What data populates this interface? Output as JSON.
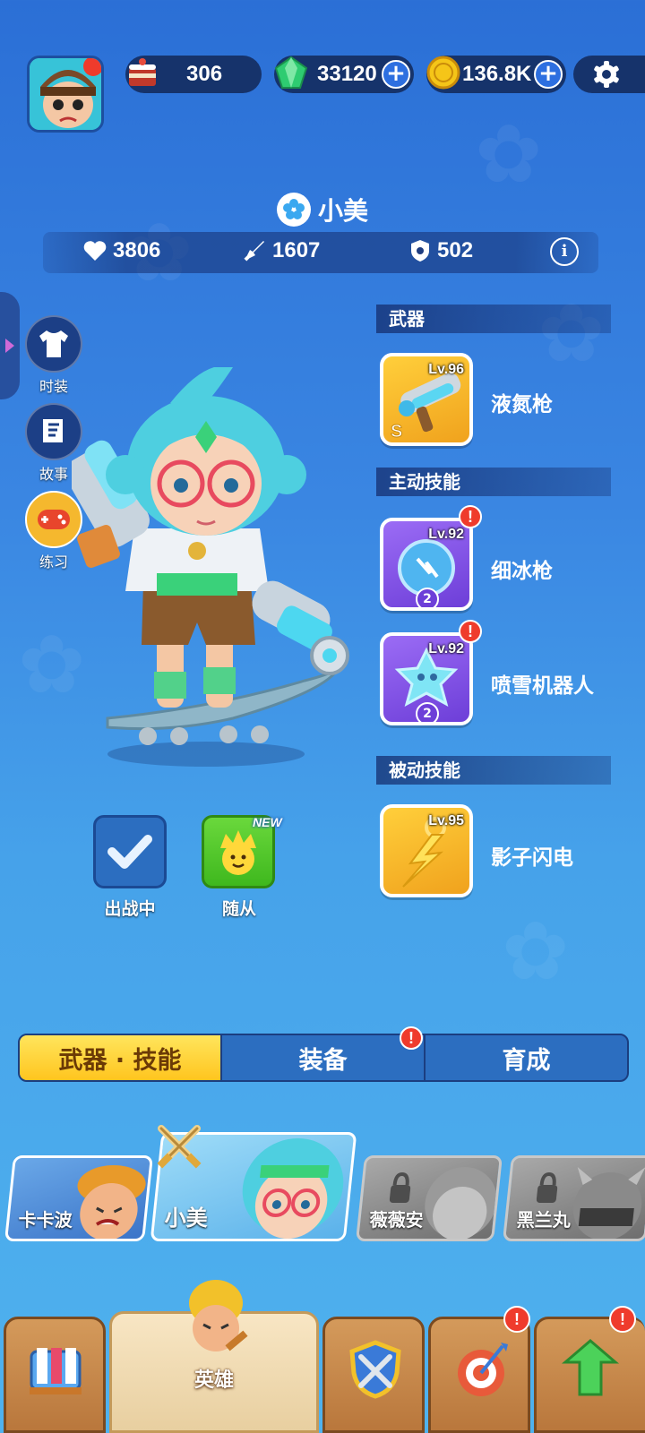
{
  "top_bar": {
    "cake": {
      "value": "306",
      "icon": "cake-icon"
    },
    "gems": {
      "value": "33120",
      "icon": "gem-icon",
      "add": "+"
    },
    "coins": {
      "value": "136.8K",
      "icon": "coin-icon",
      "add": "+"
    },
    "settings_icon": "gear-icon"
  },
  "hero": {
    "name": "小美",
    "stats": {
      "hp": "3806",
      "attack": "1607",
      "defense": "502"
    }
  },
  "side_menu": [
    {
      "label": "时装",
      "icon": "shirt-icon"
    },
    {
      "label": "故事",
      "icon": "book-icon"
    },
    {
      "label": "练习",
      "icon": "gamepad-icon"
    }
  ],
  "sections": {
    "weapon": "武器",
    "active": "主动技能",
    "passive": "被动技能"
  },
  "skills": {
    "weapon": {
      "level": "Lv.96",
      "name": "液氮枪"
    },
    "active1": {
      "level": "Lv.92",
      "name": "细冰枪",
      "star": "2",
      "alert": "!"
    },
    "active2": {
      "level": "Lv.92",
      "name": "喷雪机器人",
      "star": "2",
      "alert": "!"
    },
    "passive": {
      "level": "Lv.95",
      "name": "影子闪电"
    }
  },
  "actions": {
    "deploy": "出战中",
    "follower": "随从",
    "new_tag": "NEW"
  },
  "tabs": [
    {
      "label": "武器 · 技能",
      "active": true
    },
    {
      "label": "装备",
      "alert": "!"
    },
    {
      "label": "育成"
    }
  ],
  "heroes": [
    {
      "name": "卡卡波",
      "locked": false
    },
    {
      "name": "小美",
      "locked": false,
      "selected": true
    },
    {
      "name": "薇薇安",
      "locked": true
    },
    {
      "name": "黑兰丸",
      "locked": true
    }
  ],
  "nav": {
    "hero_label": "英雄",
    "alert": "!"
  },
  "colors": {
    "accent_yellow": "#ffc51f",
    "alert_red": "#ef3b2c",
    "panel_navy": "#16336b"
  }
}
